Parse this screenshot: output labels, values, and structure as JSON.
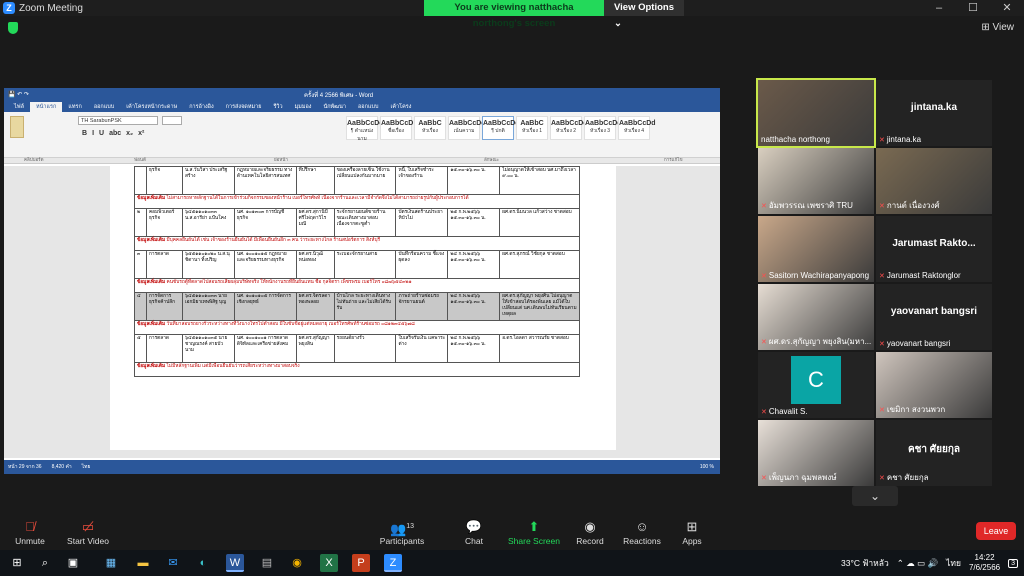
{
  "window": {
    "title": "Zoom Meeting",
    "controls": [
      "–",
      "☐",
      "✕"
    ]
  },
  "share_banner": {
    "text": "You are viewing natthacha northong's screen",
    "options_label": "View Options"
  },
  "view_label": "View",
  "word": {
    "doc_title": "ครั้งที่ 4 2566 พิเศษ - Word",
    "tabs": [
      "ไฟล์",
      "หน้าแรก",
      "แทรก",
      "ออกแบบ",
      "เค้าโครงหน้ากระดาษ",
      "การอ้างอิง",
      "การส่งจดหมาย",
      "รีวิว",
      "มุมมอง",
      "นักพัฒนา",
      "ออกแบบ",
      "เค้าโครง"
    ],
    "font_name": "TH SarabunPSK",
    "format_buttons": [
      "B",
      "I",
      "U",
      "abc",
      "x₂",
      "x²"
    ],
    "styles": [
      {
        "sample": "AaBbCcDc",
        "name": "¶ ตำแหน่งนาม"
      },
      {
        "sample": "AaBbCcD",
        "name": "ชื่อเรื่อง"
      },
      {
        "sample": "AaBbC",
        "name": "หัวเรื่อง"
      },
      {
        "sample": "AaBbCcDc",
        "name": "เน้นความ"
      },
      {
        "sample": "AaBbCcDc",
        "name": "¶ ปกติ"
      },
      {
        "sample": "AaBbC",
        "name": "หัวเรื่อง 1"
      },
      {
        "sample": "AaBbCcDc",
        "name": "หัวเรื่อง 2"
      },
      {
        "sample": "AaBbCcDd",
        "name": "หัวเรื่อง 3"
      },
      {
        "sample": "AaBbCcDd",
        "name": "หัวเรื่อง 4"
      }
    ],
    "group_labels": [
      "คลิปบอร์ด",
      "ฟอนต์",
      "ย่อหน้า",
      "ลักษณะ",
      "การแก้ไข"
    ],
    "table_rows": [
      {
        "type": "row",
        "cells": [
          "",
          "ธุรกิจ",
          "น.ส.วันวิสา ประเสริฐสร้าง",
          "กฎหมายและจริยธรรม ทางด้านเทคโนโลยีสารสนเทศ",
          "ที่ปรึกษา",
          "ของเครื่องลายเซ็น ใช้งานเปลี่ยนแปลงกันมากมาย",
          "หนี้, ใบเสร็จชำระเจ้าของร้าน",
          "๑๕.๓๐-๑๖.๓๐ น.",
          "ไม่อนุญาตให้เข้าสอบ นศ.มาถึงเวลา ๙.๐๐ น."
        ]
      },
      {
        "type": "note",
        "label": "ข้อมูลเพิ่มเติม",
        "text": "ไม่สามารถหาหลักฐานได้ในการเข้าร่วมกิจกรรมของหน้าร้าน เบอร์โทรศัพท์ เนื่องจากร้านและเวลามีจำกัดจึงไม่ได้สามารถถ่ายรูปกับผู้ประกอบการได้"
      },
      {
        "type": "row",
        "cells": [
          "๒",
          "คอมพิวเตอร์ธุรกิจ",
          "๖๔๕๑๑๐๑๐๓๓ น.ส.อารีย่า แป้นโคง",
          "นศ. ๑๐๑๓๐๓ การบัญชีธุรกิจ",
          "ผศ.ดร.สุกานิบี ศรีไพ่ฤดาวิไรมณี",
          "ระจักรยานยนต์ขายร้าน ขณะเดินทางมาสอบเนื่องจากตะขูต่ำ",
          "บัตรเงินสดร้านประยาหิบัวไม่",
          "๒๕ ก.พ.๒๕๖๖ ๑๕.๓๐-๑๖.๓๐ น.",
          "ผศ.ดร.นิ่มนวล แก้วสว่าง ชาตสอบ"
        ]
      },
      {
        "type": "note",
        "label": "ข้อมูลเพิ่มเติม",
        "text": "มีบุคคลยืนยันได้ เช่น เจ้าของร้านยืนยันได้ มีเพื่อนยืนยันอีก ๓ คน ว่าระยะทางไกล ร้านสปอร์ตการ สิงห์บุรี"
      },
      {
        "type": "row",
        "cells": [
          "๓",
          "การตลาด",
          "๖๕๕๑๑๐๑๐๒๐ น.ส.นุชิดานา ทิ้งปริญ",
          "นศ. ๑๐๐๑๐๑๕ กฎหมายและจริยธรรมทางธุรกิจ",
          "ผศ.ดร.นิวุฒิ หน่อทอง",
          "ระเบอะจักรยานสาย",
          "บันทึกร้อนความ ชี้แจงผุดลง",
          "๒๔ ก.พ.๒๕๖๖ ๑๕.๓๐-๑๖.๓๐ น.",
          "ผศ.ดร.สุภรณ์ วิชัยกุล ชาตสอบ"
        ]
      },
      {
        "type": "note",
        "label": "ข้อมูลเพิ่มเติม",
        "text": "คนขับรถตู้ที่ตลาดไปสอนรถเสียผลุ่มบริษัทจริง ให้หนักงานรถที่ยืนยันแทน ชื่อ กุลจิตรา เพ็ชรพรม เบอร์โทร ๐๘๗๖๕๔๓๒๑"
      },
      {
        "type": "hl",
        "cells": [
          "๔",
          "การจัดการธุรกิจค้าปลีก",
          "๖๔๕๑๑๐๑๐๓๓ นายเอกมิยาเทพพิสิฐ บุญ",
          "นศ. ๑๐๑๐๑๐๕ การจัดการเชิงกลยุทธ์",
          "ผศ.ดร.จิตรลดา ทองพลอย",
          "บ้านไกล ระยะทางเดินทางไม่ทันถ่าย และไม่เสียได้รับรับ",
          "ภาพถ่ายร้านซ่อมรถจักรยานยนต์",
          "๒๔ ก.พ.๒๕๖๖ ๑๕.๓๐-๑๖.๓๐ น.",
          "ผศ.ดร.สุภัญญา พยุงศิน ไม่อนุญาตให้เข้าสอบได้รองพ้นเลย แม้ได้ใบเปลี่ยนแต่ นศ.เดินพบไม่ทันเรียนตามเหตุผล"
        ]
      },
      {
        "type": "note",
        "label": "ข้อมูลเพิ่มเติม",
        "text": "วันที่มาสอบรถยางรั่วระหว่างทางที่วังนางโทรไปตำสอบ มีใบขับขี่อยู่แต่หมดอายุ เบอร์โทรศัพท์ร้านซ่อมรถ ๐๘๑๒๓๔๕๖๗๘"
      },
      {
        "type": "row",
        "cells": [
          "๕",
          "การตลาด",
          "๖๔๕๑๑๐๑๐๓๕ นายชาญณรงค์ สายบัวนาม",
          "นศ. ๑๐๐๑๐๐๑ การตลาดดิจิทัลและเครือข่ายสังคม",
          "ผศ.ดร.สุกัญญา พยุงสิน",
          "รถยนต์ยางรั่ว",
          "ใบเสร็จรับเงิน แคพาระต่าง",
          "๒๔ ก.พ.๒๕๖๖ ๑๕.๓๐-๑๖.๓๐ น.",
          "อ.ดร.ไอลดา สวารณรัย ชาตสอบ"
        ]
      },
      {
        "type": "note",
        "label": "ข้อมูลเพิ่มเติม",
        "text": "ไม่มีหลักฐานเพิ่ม แต่มีเพื่อนยืนยันว่ารถเสียระหว่างทางมาสอบจริง"
      }
    ],
    "status": {
      "page": "หน้า 29 จาก 36",
      "words": "8,420 คำ",
      "lang": "ไทย",
      "zoom": "100 %"
    }
  },
  "participants": [
    {
      "name": "natthacha northong",
      "type": "video",
      "muted": false
    },
    {
      "name": "jintana.ka",
      "type": "name",
      "muted": true
    },
    {
      "name": "อัมพวรรณ เพชราศิ TRU",
      "type": "video",
      "muted": true
    },
    {
      "name": "กานต์ เนื่องวงศ์",
      "type": "video",
      "muted": true
    },
    {
      "name": "Sasitorn Wachirapanyapong",
      "type": "video",
      "muted": true
    },
    {
      "name": "Jarumast Raktonglor",
      "type": "name",
      "big_label": "Jarumast Rakto...",
      "muted": true
    },
    {
      "name": "ผศ.ดร.สุกัญญา พยุงสิน(มหา...",
      "type": "video",
      "muted": true
    },
    {
      "name": "yaovanart bangsri",
      "type": "name",
      "muted": true
    },
    {
      "name": "Chavalit S.",
      "type": "avatar",
      "initial": "C",
      "muted": true
    },
    {
      "name": "เขมิกา สงวนพวก",
      "type": "video",
      "muted": true
    },
    {
      "name": "เพ็ญนภา ฉุมพลพงษ์",
      "type": "video",
      "muted": true
    },
    {
      "name": "คชา ศัยยกุล",
      "type": "name",
      "muted": true
    }
  ],
  "toolbar": {
    "unmute": "Unmute",
    "start_video": "Start Video",
    "participants": "Participants",
    "participants_count": "13",
    "chat": "Chat",
    "share_screen": "Share Screen",
    "record": "Record",
    "reactions": "Reactions",
    "apps": "Apps",
    "leave": "Leave"
  },
  "taskbar": {
    "weather": "33°C ฟ้าหลัว",
    "lang": "ไทย",
    "time": "14:22",
    "date": "7/6/2566",
    "notifications": "3"
  }
}
